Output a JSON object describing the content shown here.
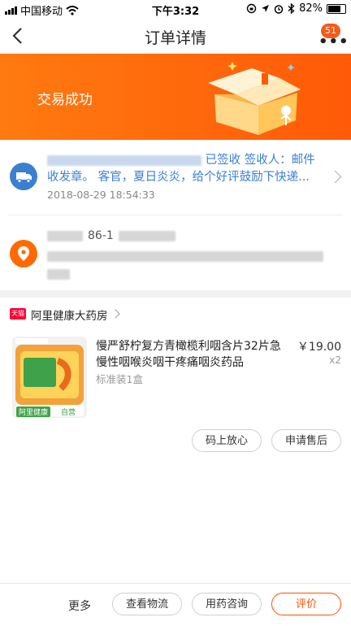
{
  "status_bar": {
    "carrier": "中国移动",
    "time": "下午3:32",
    "battery": "82%",
    "battery_level": 0.82
  },
  "header": {
    "title": "订单详情",
    "message_count": "51",
    "more_label": "•••"
  },
  "banner": {
    "status_text": "交易成功",
    "colors": {
      "start": "#ff7a10",
      "end": "#ff5a08"
    }
  },
  "logistics": {
    "message": "已签收 签收人：邮件收发章。 客官，夏日炎炎，给个好评鼓励下快递...",
    "time": "2018-08-29 18:54:33",
    "icon": "truck-icon"
  },
  "address": {
    "phone": "86-1",
    "icon": "location-pin-icon"
  },
  "shop": {
    "badge": "天猫",
    "name": "阿里健康大药房"
  },
  "product": {
    "title": "慢严舒柠复方青橄榄利咽含片32片急慢性咽喉炎咽干疼痛咽炎药品",
    "price": "￥19.00",
    "quantity": "x2",
    "spec": "标准装1盒",
    "image_labels": {
      "brand": "阿里健康",
      "tag": "自营"
    },
    "actions": [
      "码上放心",
      "申请售后"
    ]
  },
  "bottom_bar": {
    "more_label": "更多",
    "buttons": [
      "查看物流",
      "用药咨询",
      "评价"
    ]
  },
  "colors": {
    "accent": "#ff5000",
    "link_blue": "#3b7fd1",
    "tmall_red": "#ff0036"
  }
}
